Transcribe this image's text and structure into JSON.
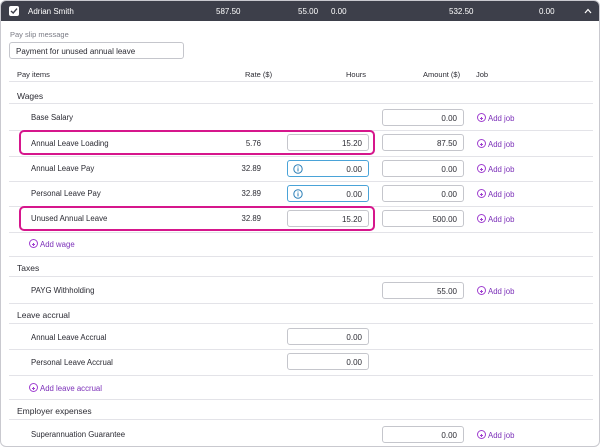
{
  "employee": {
    "name": "Adrian Smith",
    "col1": "587.50",
    "col2": "55.00",
    "col3": "0.00",
    "col4": "532.50",
    "col5": "0.00"
  },
  "payslip": {
    "label": "Pay slip message",
    "value": "Payment for unused annual leave"
  },
  "columns": {
    "pay_items": "Pay items",
    "rate": "Rate ($)",
    "hours": "Hours",
    "amount": "Amount ($)",
    "job": "Job"
  },
  "sections": {
    "wages": "Wages",
    "taxes": "Taxes",
    "leave_accrual": "Leave accrual",
    "employer_expenses": "Employer expenses"
  },
  "wages": [
    {
      "label": "Base Salary",
      "rate": "",
      "hours": "",
      "amount": "0.00",
      "job": "Add job"
    },
    {
      "label": "Annual Leave Loading",
      "rate": "5.76",
      "hours": "15.20",
      "amount": "87.50",
      "job": "Add job"
    },
    {
      "label": "Annual Leave Pay",
      "rate": "32.89",
      "hours": "0.00",
      "amount": "0.00",
      "job": "Add job"
    },
    {
      "label": "Personal Leave Pay",
      "rate": "32.89",
      "hours": "0.00",
      "amount": "0.00",
      "job": "Add job"
    },
    {
      "label": "Unused Annual Leave",
      "rate": "32.89",
      "hours": "15.20",
      "amount": "500.00",
      "job": "Add job"
    }
  ],
  "add_wage": "Add wage",
  "taxes": [
    {
      "label": "PAYG Withholding",
      "amount": "55.00",
      "job": "Add job"
    }
  ],
  "leave": [
    {
      "label": "Annual Leave Accrual",
      "hours": "0.00"
    },
    {
      "label": "Personal Leave Accrual",
      "hours": "0.00"
    }
  ],
  "add_leave": "Add leave accrual",
  "expenses": [
    {
      "label": "Superannuation Guarantee",
      "amount": "0.00",
      "job": "Add job"
    }
  ],
  "colors": {
    "header_bg": "#3d3f4a",
    "highlight": "#d6168c",
    "link": "#7b2fb8",
    "info_border": "#4aa3d8"
  },
  "icons": {
    "checkbox": "checkbox-checked-icon",
    "collapse": "chevron-up-icon",
    "info": "info-icon",
    "add": "plus-circle-icon"
  }
}
